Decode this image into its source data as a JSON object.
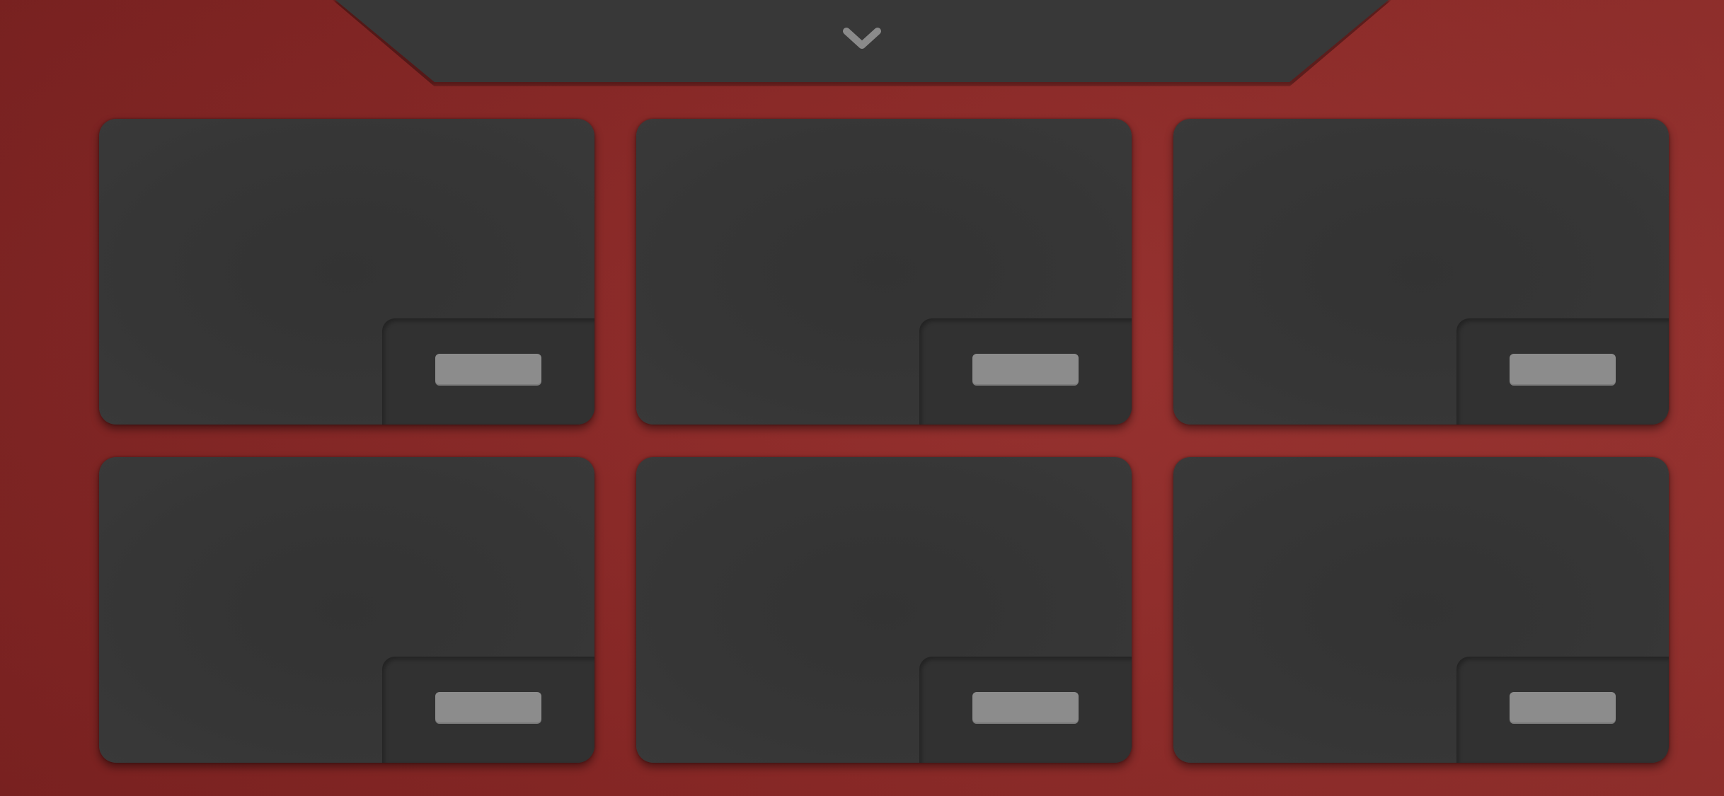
{
  "theme": {
    "background": "#8f2826",
    "panel": "#383838",
    "card": "#363636",
    "card_inset": "#313131",
    "bar": "#8c8c8c",
    "chevron": "#8a8a8a"
  },
  "top_tab": {
    "icon": "chevron-down-icon"
  },
  "cards": [
    {
      "label": ""
    },
    {
      "label": ""
    },
    {
      "label": ""
    },
    {
      "label": ""
    },
    {
      "label": ""
    },
    {
      "label": ""
    }
  ]
}
